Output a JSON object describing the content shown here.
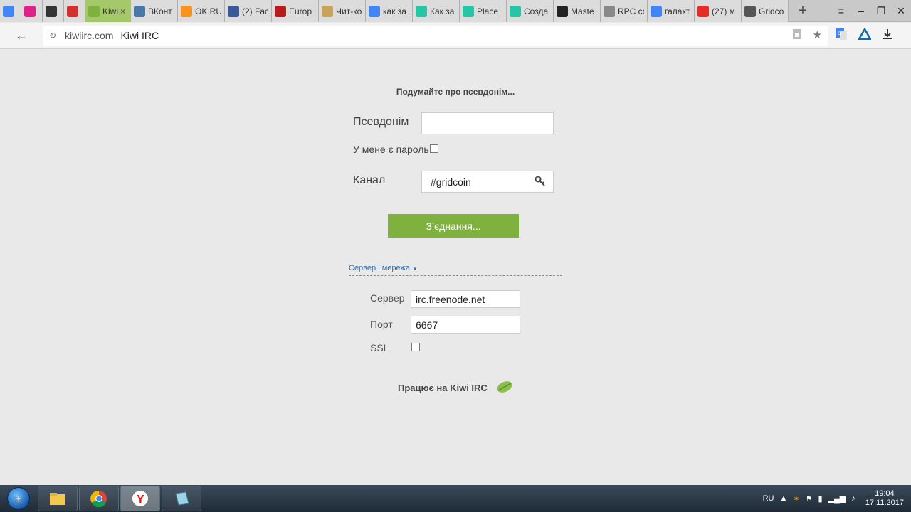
{
  "browser": {
    "tabs": [
      {
        "favicon": "google-icon",
        "title": "",
        "color": "#4285f4"
      },
      {
        "favicon": "pink-app-icon",
        "title": "",
        "color": "#e0218a"
      },
      {
        "favicon": "p-icon",
        "title": "",
        "color": "#333333"
      },
      {
        "favicon": "red-circle-icon",
        "title": "",
        "color": "#d32f2f"
      },
      {
        "favicon": "kiwi-leaf-icon",
        "title": "Kiwi",
        "color": "#7fb13f",
        "active": true
      },
      {
        "favicon": "vk-icon",
        "title": "ВКонт",
        "color": "#4a76a8"
      },
      {
        "favicon": "ok-icon",
        "title": "OK.RU",
        "color": "#f7931e"
      },
      {
        "favicon": "facebook-icon",
        "title": "(2) Fac",
        "color": "#3b5998"
      },
      {
        "favicon": "europa-icon",
        "title": "Europ",
        "color": "#b71c1c"
      },
      {
        "favicon": "s-icon",
        "title": "Чит-ко",
        "color": "#c8a35a"
      },
      {
        "favicon": "google-icon",
        "title": "как за",
        "color": "#4285f4"
      },
      {
        "favicon": "green-circle-icon",
        "title": "Как за",
        "color": "#26c6a5"
      },
      {
        "favicon": "green-circle-icon",
        "title": "Place",
        "color": "#26c6a5"
      },
      {
        "favicon": "green-circle-icon",
        "title": "Созда",
        "color": "#26c6a5"
      },
      {
        "favicon": "github-icon",
        "title": "Maste",
        "color": "#222222"
      },
      {
        "favicon": "document-icon",
        "title": "RPC co",
        "color": "#888888"
      },
      {
        "favicon": "google-icon",
        "title": "галакт",
        "color": "#4285f4"
      },
      {
        "favicon": "youtube-icon",
        "title": "(27) м",
        "color": "#e52d27"
      },
      {
        "favicon": "gridcoin-icon",
        "title": "Gridco",
        "color": "#555555"
      }
    ],
    "close_glyph": "×",
    "new_tab_glyph": "+",
    "window_controls": [
      "≡",
      "–",
      "❐",
      "✕"
    ],
    "back_glyph": "←",
    "reload_glyph": "↻",
    "url_domain": "kiwiirc.com",
    "page_title": "Kiwi IRC",
    "star_glyph": "★"
  },
  "kiwi": {
    "headline": "Подумайте про псевдонім...",
    "nick_label": "Псевдонім",
    "nick_value": "",
    "password_label": "У мене є пароль",
    "channel_label": "Канал",
    "channel_value": "#gridcoin",
    "connect_label": "З’єднання...",
    "server_toggle": "Сервер і мережа",
    "server_label": "Сервер",
    "server_value": "irc.freenode.net",
    "port_label": "Порт",
    "port_value": "6667",
    "ssl_label": "SSL",
    "powered_by": "Працює на Kiwi IRC"
  },
  "taskbar": {
    "language": "RU",
    "time": "19:04",
    "date": "17.11.2017"
  },
  "colors": {
    "accent": "#7fb13f",
    "link": "#2a6fb5",
    "background": "#e9e9e9"
  }
}
